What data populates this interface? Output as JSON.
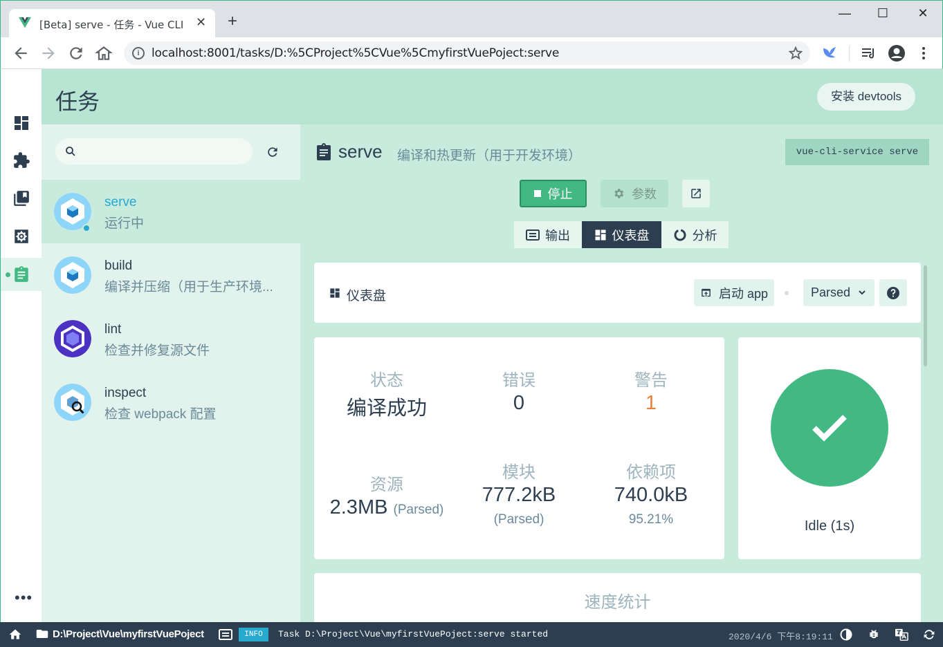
{
  "browser": {
    "tab_title": "[Beta] serve - 任务 - Vue CLI",
    "tab_close": "✕",
    "new_tab": "+",
    "url": "localhost:8001/tasks/D:%5CProject%5CVue%5CmyfirstVuePoject:serve",
    "window_controls": {
      "minimize": "—",
      "maximize": "☐",
      "close": "✕"
    }
  },
  "header": {
    "title": "任务",
    "devtools_button": "安装 devtools"
  },
  "sidebar": {
    "items": [
      {
        "icon": "dashboard-icon"
      },
      {
        "icon": "puzzle-plugin-icon"
      },
      {
        "icon": "library-dependencies-icon"
      },
      {
        "icon": "settings-gear-icon"
      },
      {
        "icon": "clipboard-tasks-icon",
        "active": true
      }
    ],
    "more": "•••"
  },
  "task_list": {
    "search_placeholder": "",
    "tasks": [
      {
        "name": "serve",
        "description": "运行中",
        "active": true
      },
      {
        "name": "build",
        "description": "编译并压缩（用于生产环境..."
      },
      {
        "name": "lint",
        "description": "检查并修复源文件"
      },
      {
        "name": "inspect",
        "description": "检查 webpack 配置"
      }
    ]
  },
  "task": {
    "name": "serve",
    "description": "编译和热更新（用于开发环境）",
    "command": "vue-cli-service serve",
    "stop_label": "停止",
    "params_label": "参数",
    "tabs": [
      {
        "label": "输出",
        "icon": "output-list-icon"
      },
      {
        "label": "仪表盘",
        "icon": "dashboard-icon",
        "active": true
      },
      {
        "label": "分析",
        "icon": "analyzer-ring-icon"
      }
    ]
  },
  "dashboard": {
    "title": "仪表盘",
    "launch_label": "启动 app",
    "select_value": "Parsed",
    "stats": {
      "status_label": "状态",
      "status_value": "编译成功",
      "errors_label": "错误",
      "errors_value": "0",
      "warnings_label": "警告",
      "warnings_value": "1",
      "assets_label": "资源",
      "assets_value": "2.3MB",
      "assets_sub": "(Parsed)",
      "modules_label": "模块",
      "modules_value": "777.2kB",
      "modules_sub": "(Parsed)",
      "deps_label": "依赖项",
      "deps_value": "740.0kB",
      "deps_sub": "95.21%"
    },
    "build_status": "Idle (1s)",
    "speed_title": "速度统计"
  },
  "statusbar": {
    "path": "D:\\Project\\Vue\\myfirstVuePoject",
    "badge": "INFO",
    "message": "Task D:\\Project\\Vue\\myfirstVuePoject:serve started",
    "time": "2020/4/6 下午8:19:11"
  },
  "colors": {
    "accent": "#42b983",
    "dark": "#2c3e50",
    "warning": "#e8803c",
    "info": "#26a8cf",
    "header_bg": "#b7e4d3",
    "panel_bg": "#e2f2ec"
  }
}
